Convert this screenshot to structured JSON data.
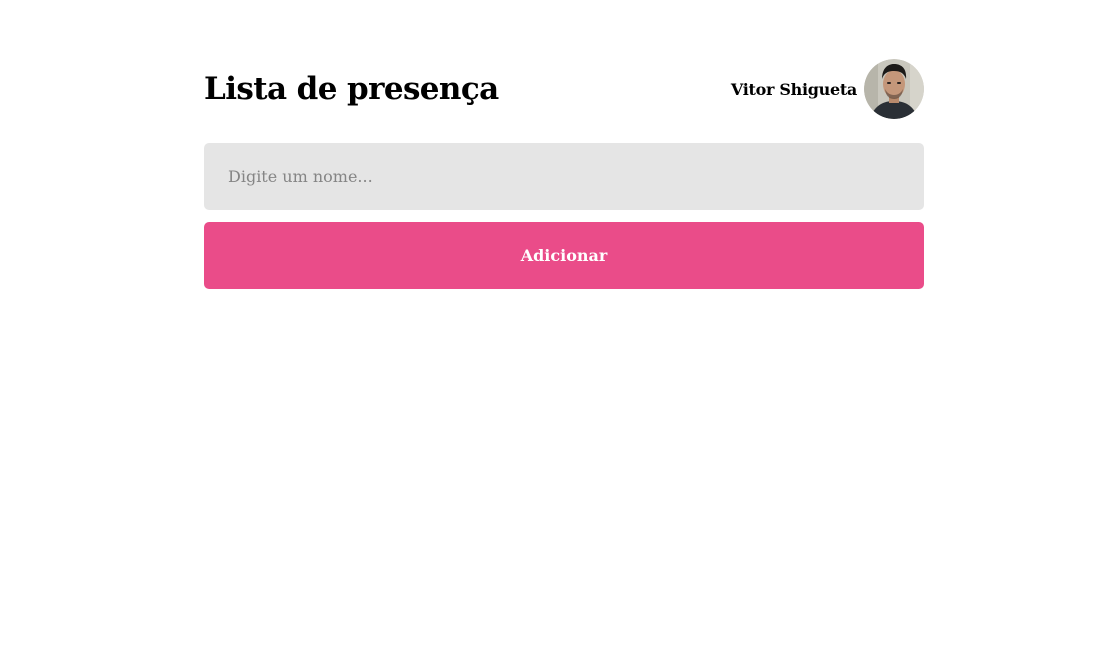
{
  "header": {
    "title": "Lista de presença",
    "user": {
      "name": "Vitor Shigueta",
      "avatar_icon": "user-avatar-photo"
    }
  },
  "form": {
    "input_placeholder": "Digite um nome...",
    "input_value": "",
    "add_button_label": "Adicionar"
  },
  "colors": {
    "accent": "#ea4c89",
    "input_background": "#e5e5e5",
    "placeholder": "#858585",
    "page_background": "#ffffff"
  }
}
